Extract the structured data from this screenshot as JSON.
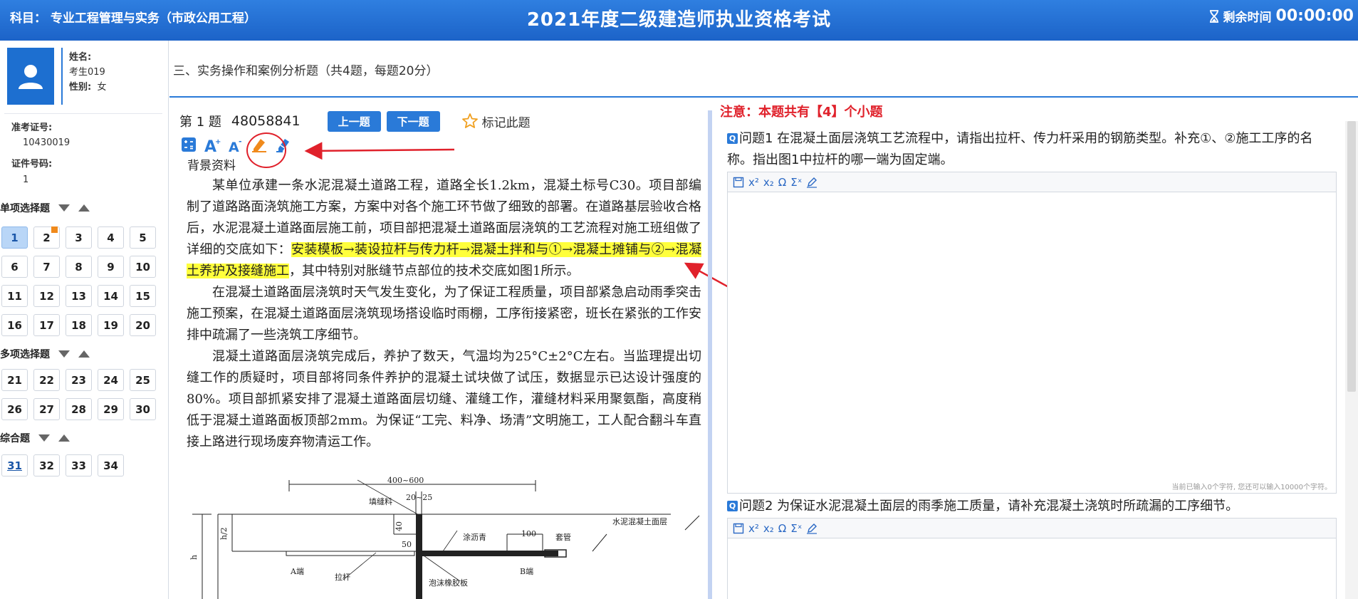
{
  "header": {
    "subject": "科目：   专业工程管理与实务（市政公用工程）",
    "title": "2021年度二级建造师执业资格考试",
    "timer_label": "剩余时间",
    "timer_value": "00:00:00"
  },
  "candidate": {
    "name_label": "姓名:",
    "name_value": "考生019",
    "gender_label": "性别:",
    "gender_value": "女",
    "exam_no_label": "准考证号:",
    "exam_no_value": "10430019",
    "id_label": "证件号码:",
    "id_value": "1"
  },
  "navigator": {
    "single_title": "单项选择题",
    "single": [
      "1",
      "2",
      "3",
      "4",
      "5",
      "6",
      "7",
      "8",
      "9",
      "10",
      "11",
      "12",
      "13",
      "14",
      "15",
      "16",
      "17",
      "18",
      "19",
      "20"
    ],
    "multi_title": "多项选择题",
    "multi": [
      "21",
      "22",
      "23",
      "24",
      "25",
      "26",
      "27",
      "28",
      "29",
      "30"
    ],
    "case_title": "综合题",
    "case": [
      "31",
      "32",
      "33",
      "34"
    ],
    "current": "1",
    "flagged": "2"
  },
  "section": {
    "title": "三、实务操作和案例分析题（共4题，每题20分）"
  },
  "question": {
    "number": "第 1 题",
    "id": "48058841",
    "prev_label": "上一题",
    "next_label": "下一题",
    "mark_label": "标记此题",
    "bg_title": "背景资料",
    "p1_a": "某单位承建一条水泥混凝土道路工程，道路全长1.2km，混凝土标号C30。项目部编制了道路路面浇筑施工方案，方案中对各个施工环节做了细致的部署。在道路基层验收合格后，水泥混凝土道路面层施工前，项目部把混凝土道路面层浇筑的工艺流程对施工班组做了详细的交底如下：",
    "p1_highlight": "安装模板→装设拉杆与传力杆→混凝土拌和与①→混凝土摊铺与②→混凝土养护及接缝施工",
    "p1_b": "，其中特别对胀缝节点部位的技术交底如图1所示。",
    "p2": "在混凝土道路面层浇筑时天气发生变化，为了保证工程质量，项目部紧急启动雨季突击施工预案，在混凝土道路面层浇筑现场搭设临时雨棚，工序衔接紧密，班长在紧张的工作安排中疏漏了一些浇筑工序细节。",
    "p3": "混凝土道路面层浇筑完成后，养护了数天，气温均为25°C±2°C左右。当监理提出切缝工作的质疑时，项目部将同条件养护的混凝土试块做了试压，数据显示已达设计强度的80%。项目部抓紧安排了混凝土道路面层切缝、灌缝工作，灌缝材料采用聚氨酯，高度稍低于混凝土道路面板顶部2mm。为保证“工完、料净、场清”文明施工，工人配合翻斗车直接上路进行现场废弃物清运工作。"
  },
  "figure": {
    "dim_top": "400~600",
    "dim_2025": "20~25",
    "dim_100": "100",
    "dim_40": "40",
    "dim_50": "50",
    "dim_h2": "h/2",
    "dim_h": "h",
    "filler": "填缝料",
    "asphalt": "涂沥青",
    "sleeve": "套管",
    "surface": "水泥混凝土面层",
    "end_a": "A端",
    "end_b": "B端",
    "tie_bar": "拉杆",
    "foam": "泡沫橡胶板"
  },
  "answer": {
    "notice": "注意：本题共有【4】个小题",
    "q_icon": "Q",
    "q1": "问题1  在混凝土面层浇筑工艺流程中，请指出拉杆、传力杆采用的钢筋类型。补充①、②施工工序的名称。指出图1中拉杆的哪一端为固定端。",
    "q2": "问题2  为保证水泥混凝土面层的雨季施工质量，请补充混凝土浇筑时所疏漏的工序细节。",
    "counter": "当前已输入0个字符, 您还可以输入10000个字符。",
    "tb_omega": "Ω",
    "tb_sigma": "Σˣ",
    "tb_sup": "x²",
    "tb_sub": "x₂"
  },
  "colors": {
    "header_blue": "#1c63c8",
    "accent_blue": "#2a7ad8",
    "highlight": "#ffff3c",
    "annotation_red": "#e0212b",
    "flag_orange": "#f08a1c"
  }
}
